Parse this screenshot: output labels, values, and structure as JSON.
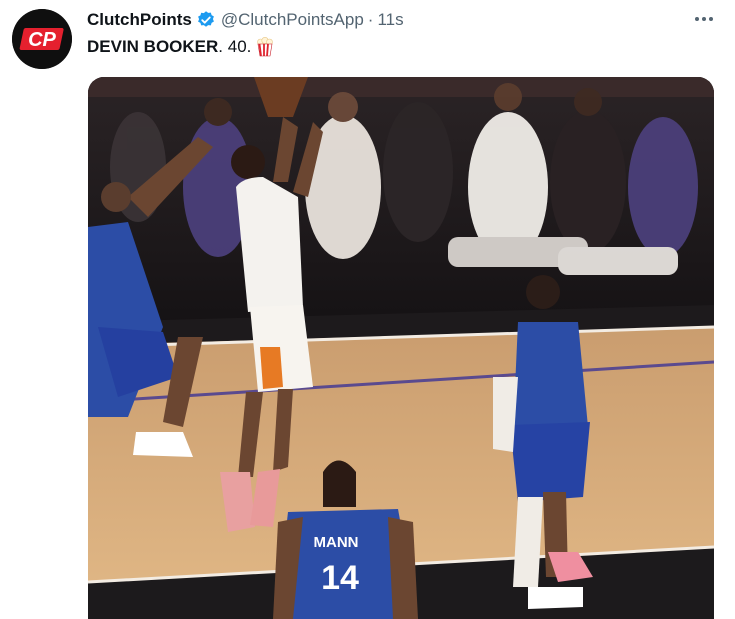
{
  "tweet": {
    "author": {
      "name": "ClutchPoints",
      "handle": "@ClutchPointsApp",
      "avatar_text": "CP"
    },
    "separator": "·",
    "time": "11s",
    "text_bold": "DEVIN BOOKER",
    "text_rest": ". 40.",
    "emoji": "popcorn-icon",
    "more_glyph": "···"
  },
  "media": {
    "jersey_name": "MANN",
    "jersey_number": "14"
  },
  "colors": {
    "brand_red": "#e5202e",
    "verified_blue": "#1d9bf0",
    "secondary_text": "#536471",
    "court_wood": "#d9ab7b",
    "clippers_blue": "#2c4da6"
  }
}
